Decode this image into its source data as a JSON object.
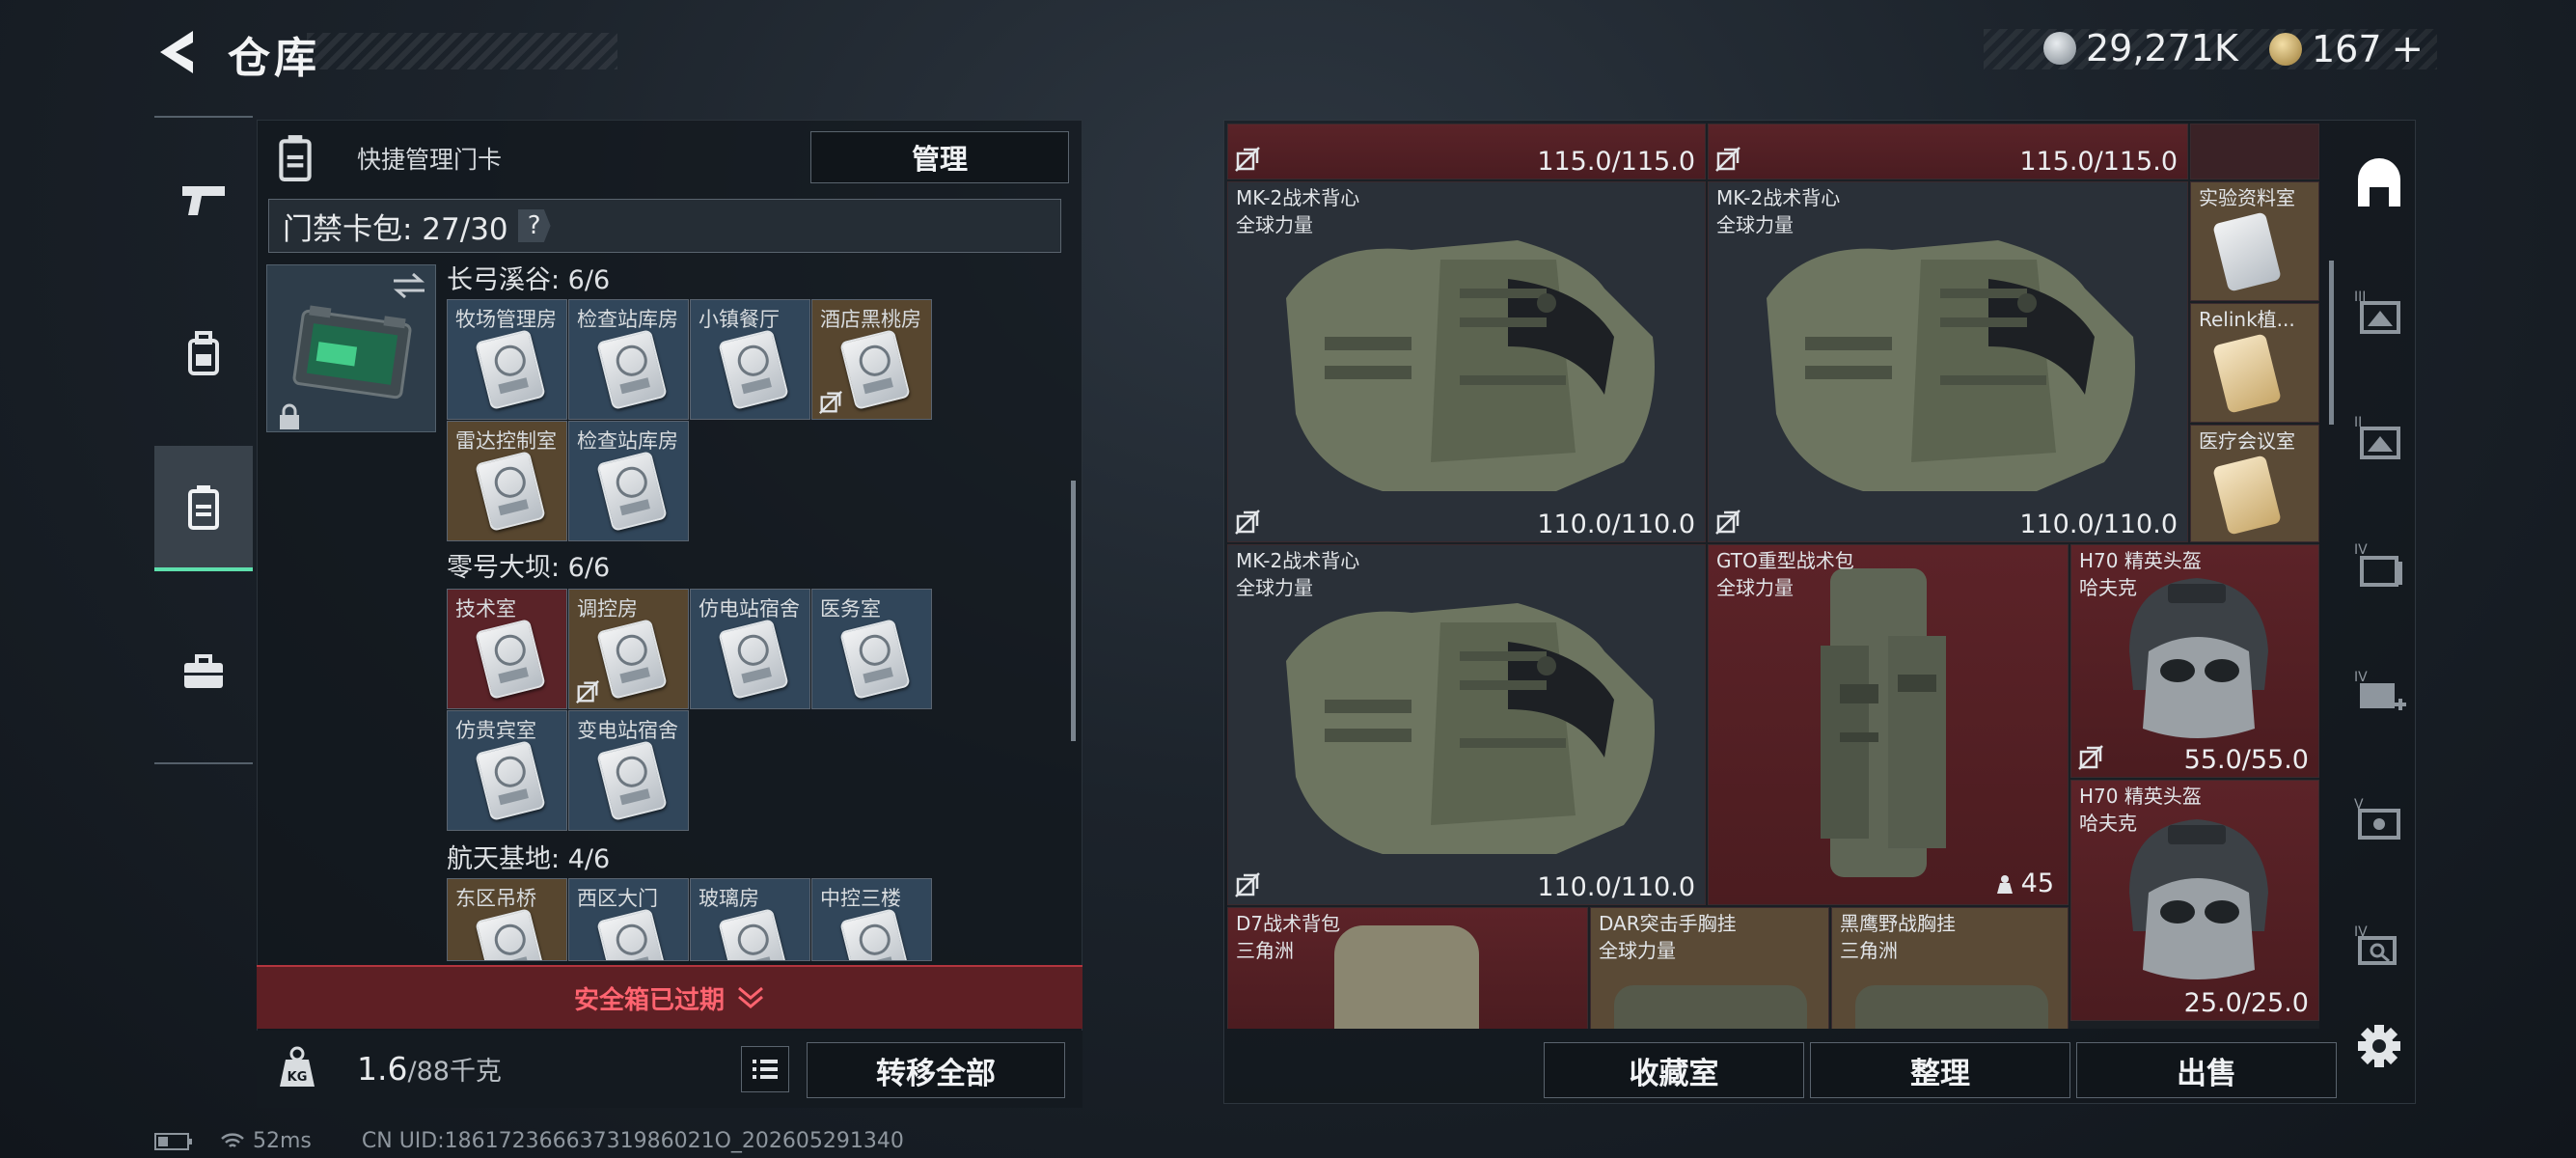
{
  "header": {
    "title": "仓库",
    "back_icon": "chevron-left-icon"
  },
  "currency": [
    {
      "icon": "silver-coin-icon",
      "value": "29,271K",
      "color": "#aeb6bd"
    },
    {
      "icon": "gold-coin-icon",
      "value": "167",
      "suffix": "+",
      "color": "#c9a45b"
    }
  ],
  "left_nav": [
    {
      "icon": "pistol-icon",
      "active": false
    },
    {
      "icon": "backpack-icon",
      "active": false
    },
    {
      "icon": "keycard-icon",
      "active": true
    },
    {
      "icon": "toolbox-icon",
      "active": false
    }
  ],
  "quick_manage": {
    "label": "快捷管理门卡",
    "button": "管理"
  },
  "card_bag": {
    "label": "门禁卡包: 27/30",
    "help": "?"
  },
  "regions": [
    {
      "name": "长弓溪谷: 6/6",
      "rooms": [
        {
          "name": "牧场管理房",
          "tone": "blue",
          "no_extract": false
        },
        {
          "name": "检查站库房",
          "tone": "blue",
          "no_extract": false
        },
        {
          "name": "小镇餐厅",
          "tone": "blue",
          "no_extract": false
        },
        {
          "name": "酒店黑桃房",
          "tone": "brown",
          "no_extract": true
        },
        {
          "name": "雷达控制室",
          "tone": "brown",
          "no_extract": false
        },
        {
          "name": "检查站库房",
          "tone": "blue",
          "no_extract": false
        }
      ]
    },
    {
      "name": "零号大坝: 6/6",
      "rooms": [
        {
          "name": "技术室",
          "tone": "red",
          "no_extract": false
        },
        {
          "name": "调控房",
          "tone": "brown",
          "no_extract": true
        },
        {
          "name": "仿电站宿舍",
          "tone": "blue",
          "no_extract": false
        },
        {
          "name": "医务室",
          "tone": "blue",
          "no_extract": false
        },
        {
          "name": "仿贵宾室",
          "tone": "blue",
          "no_extract": false
        },
        {
          "name": "变电站宿舍",
          "tone": "blue",
          "no_extract": false
        }
      ]
    },
    {
      "name": "航天基地: 4/6",
      "rooms": [
        {
          "name": "东区吊桥",
          "tone": "brown",
          "no_extract": false
        },
        {
          "name": "西区大门",
          "tone": "blue",
          "no_extract": false
        },
        {
          "name": "玻璃房",
          "tone": "blue",
          "no_extract": false
        },
        {
          "name": "中控三楼",
          "tone": "blue",
          "no_extract": false
        }
      ]
    }
  ],
  "safe_box": {
    "text": "安全箱已过期"
  },
  "capacity": {
    "value": "1.6",
    "max": "/88千克",
    "transfer_button": "转移全部"
  },
  "status": {
    "ping": "52ms",
    "uid": "CN UID:18617236663731986021O_202605291340"
  },
  "items": [
    {
      "id": "top-left",
      "dur": "115.0/115.0",
      "no_extract": true
    },
    {
      "id": "top-mid",
      "dur": "115.0/115.0",
      "no_extract": true
    },
    {
      "id": "vest1",
      "name": "MK-2战术背心",
      "sub": "全球力量",
      "dur": "110.0/110.0",
      "no_extract": true
    },
    {
      "id": "vest2",
      "name": "MK-2战术背心",
      "sub": "全球力量",
      "dur": "110.0/110.0",
      "no_extract": true
    },
    {
      "id": "card-lab",
      "name": "实验资料室"
    },
    {
      "id": "card-relink",
      "name": "Relink植..."
    },
    {
      "id": "card-med",
      "name": "医疗会议室"
    },
    {
      "id": "vest3",
      "name": "MK-2战术背心",
      "sub": "全球力量",
      "dur": "110.0/110.0",
      "no_extract": true
    },
    {
      "id": "bag",
      "name": "GTO重型战术包",
      "sub": "全球力量",
      "count": "45"
    },
    {
      "id": "helmet1",
      "name": "H70 精英头盔",
      "sub": "哈夫克",
      "dur": "55.0/55.0",
      "no_extract": true
    },
    {
      "id": "helmet2",
      "name": "H70 精英头盔",
      "sub": "哈夫克",
      "dur": "25.0/25.0"
    },
    {
      "id": "d7",
      "name": "D7战术背包",
      "sub": "三角洲"
    },
    {
      "id": "dar",
      "name": "DAR突击手胸挂",
      "sub": "全球力量"
    },
    {
      "id": "hawk",
      "name": "黑鹰野战胸挂",
      "sub": "三角洲"
    }
  ],
  "right_nav": [
    "shelter-icon",
    "storage-iii-icon",
    "storage-ii-icon",
    "storage-iv-icon",
    "storage-iv-add-icon",
    "storage-v-icon",
    "storage-iv-search-icon",
    "settings-icon"
  ],
  "bottom_buttons": {
    "collect": "收藏室",
    "sort": "整理",
    "sell": "出售"
  },
  "colors": {
    "accent": "#5ee0ad",
    "danger": "#ff6470",
    "item_red": "#5a2328"
  }
}
